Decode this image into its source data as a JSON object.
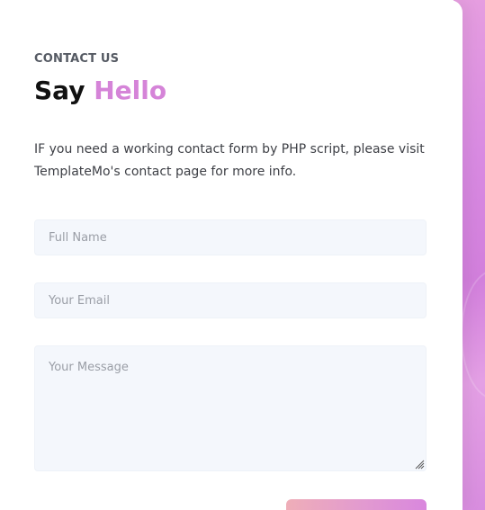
{
  "section": {
    "eyebrow": "CONTACT US",
    "title_prefix": "Say",
    "title_accent": "Hello",
    "description": "IF you need a working contact form by PHP script, please visit TemplateMo's contact page for more info."
  },
  "form": {
    "name_placeholder": "Full Name",
    "email_placeholder": "Your Email",
    "message_placeholder": "Your Message",
    "submit_label": ""
  },
  "colors": {
    "accent": "#d584d8",
    "field_background": "#f4f7fc",
    "side_panel": "#d98be2"
  },
  "icons": {
    "resize_handle": "resize-grip-icon"
  }
}
